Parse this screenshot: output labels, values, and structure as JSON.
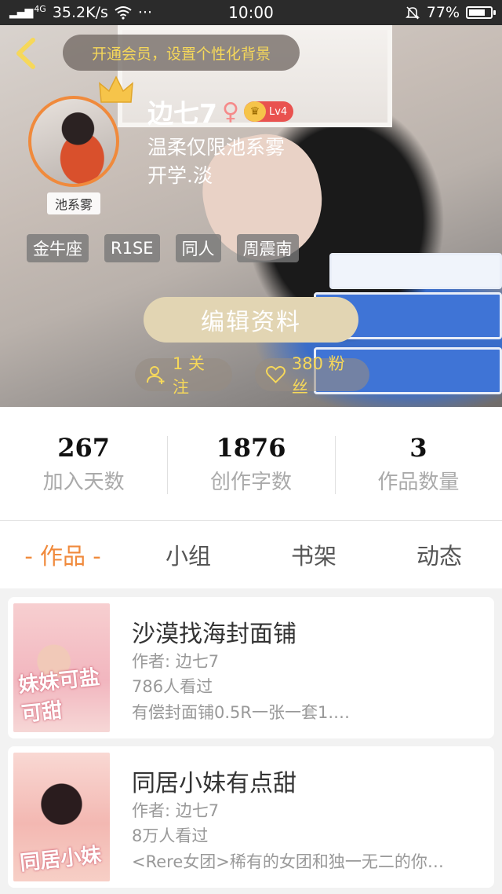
{
  "status_bar": {
    "network": "4G",
    "speed": "35.2K/s",
    "dots": "···",
    "time": "10:00",
    "battery_percent": "77%",
    "battery_level": 0.77
  },
  "header": {
    "vip_banner": "开通会员，设置个性化背景",
    "avatar_tag": "池系雾",
    "username": "边七7",
    "gender_symbol": "♀",
    "level": "Lv4",
    "bio_line1": "温柔仅限池系雾",
    "bio_line2": "开学.淡",
    "tags": [
      "金牛座",
      "R1SE",
      "同人",
      "周震南"
    ],
    "edit_button": "编辑资料",
    "following": "1 关注",
    "followers": "380 粉丝"
  },
  "stats": [
    {
      "value": "267",
      "label": "加入天数"
    },
    {
      "value": "1876",
      "label": "创作字数"
    },
    {
      "value": "3",
      "label": "作品数量"
    }
  ],
  "tabs": [
    "- 作品 -",
    "小组",
    "书架",
    "动态"
  ],
  "works": [
    {
      "title": "沙漠找海封面铺",
      "author": "作者: 边七7",
      "views": "786人看过",
      "desc": "有偿封面铺0.5R一张一套1.…",
      "cover_text": "妹妹可盐可甜"
    },
    {
      "title": "同居小妹有点甜",
      "author": "作者: 边七7",
      "views": "8万人看过",
      "desc": "<Rere女团>稀有的女团和独一无二的你…",
      "cover_text": "同居小妹"
    }
  ],
  "colors": {
    "accent": "#f08a3c",
    "vip_text": "#f6d85a",
    "edit_button": "#e2d5b3"
  }
}
